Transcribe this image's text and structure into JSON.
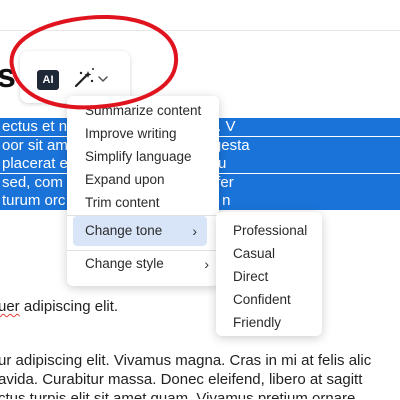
{
  "editor": {
    "heading_fragment": "s",
    "selected_lines": [
      "ectus et n                                 mes ac turpis egestas. V",
      "oor sit am                                  bero sit amet quam egesta",
      "placerat                                   e sit amet est et sapien u",
      "sed, com                                    sit amet, wisi. Aenean fer",
      "turum orc                                  us enim ac dui. Donec n"
    ],
    "line_partial": "uer adipiscing elit.",
    "line_squiggle_part": "uer",
    "paragraph_lines": [
      "ur adipiscing elit. Vivamus magna. Cras in mi at felis alic",
      "avida. Curabitur massa. Donec eleifend, libero at sagitt",
      "ctus turpis elit sit amet quam. Vivamus pretium ornare"
    ]
  },
  "toolbar": {
    "ai_label": "AI"
  },
  "menu": {
    "items": [
      {
        "label": "Summarize content"
      },
      {
        "label": "Improve writing"
      },
      {
        "label": "Simplify language"
      },
      {
        "label": "Expand upon"
      },
      {
        "label": "Trim content"
      }
    ],
    "change_tone": "Change tone",
    "change_style": "Change style"
  },
  "submenu": {
    "items": [
      {
        "label": "Professional"
      },
      {
        "label": "Casual"
      },
      {
        "label": "Direct"
      },
      {
        "label": "Confident"
      },
      {
        "label": "Friendly"
      }
    ]
  },
  "colors": {
    "selection": "#1a73d9",
    "annotation_ellipse": "#e0141e",
    "active_item_bg": "#d8e5f9",
    "ai_badge_bg": "#1f2836"
  },
  "icons": {
    "wand": "magic-wand-icon",
    "chevron": "chevron-down-icon",
    "submenu_arrow": "chevron-right-icon"
  }
}
